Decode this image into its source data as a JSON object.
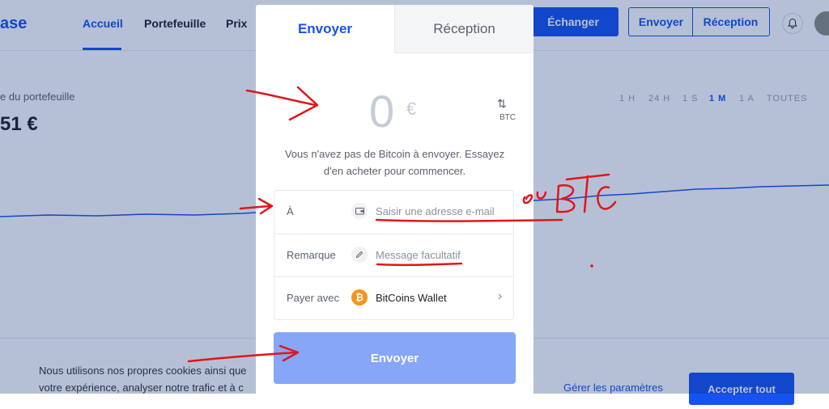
{
  "header": {
    "brand": "ase",
    "nav": [
      "Accueil",
      "Portefeuille",
      "Prix"
    ],
    "trade_label": "Échanger",
    "send_label": "Envoyer",
    "receive_label": "Réception",
    "bell_icon": "bell-icon"
  },
  "portfolio": {
    "label": "e du portefeuille",
    "value": "51 €",
    "ranges": [
      "1 H",
      "24 H",
      "1 S",
      "1 M",
      "1 A",
      "TOUTES"
    ],
    "active_range": "1 M"
  },
  "cookie": {
    "line1": "Nous utilisons nos propres cookies ainsi que",
    "line2": "votre expérience, analyser notre trafic et à c",
    "settings_label": "Gérer les paramètres",
    "accept_label": "Accepter tout"
  },
  "modal": {
    "tabs": {
      "send": "Envoyer",
      "receive": "Réception"
    },
    "amount": "0",
    "currency_symbol": "€",
    "swap_icon": "⇅",
    "swap_currency": "BTC",
    "info_line1": "Vous n'avez pas de Bitcoin à envoyer. Essayez",
    "info_line2": "d'en acheter pour commencer.",
    "to_label": "À",
    "to_placeholder": "Saisir une adresse e-mail",
    "note_label": "Remarque",
    "note_placeholder": "Message facultatif",
    "pay_label": "Payer avec",
    "wallet_name": "BitCoins Wallet",
    "send_button": "Envoyer"
  },
  "annotation": {
    "handwritten_text": "ou BTC"
  },
  "colors": {
    "accent": "#1652f0",
    "disabled_button": "#86a6f7",
    "annotation": "#e0161a",
    "bitcoin": "#f7931a"
  }
}
